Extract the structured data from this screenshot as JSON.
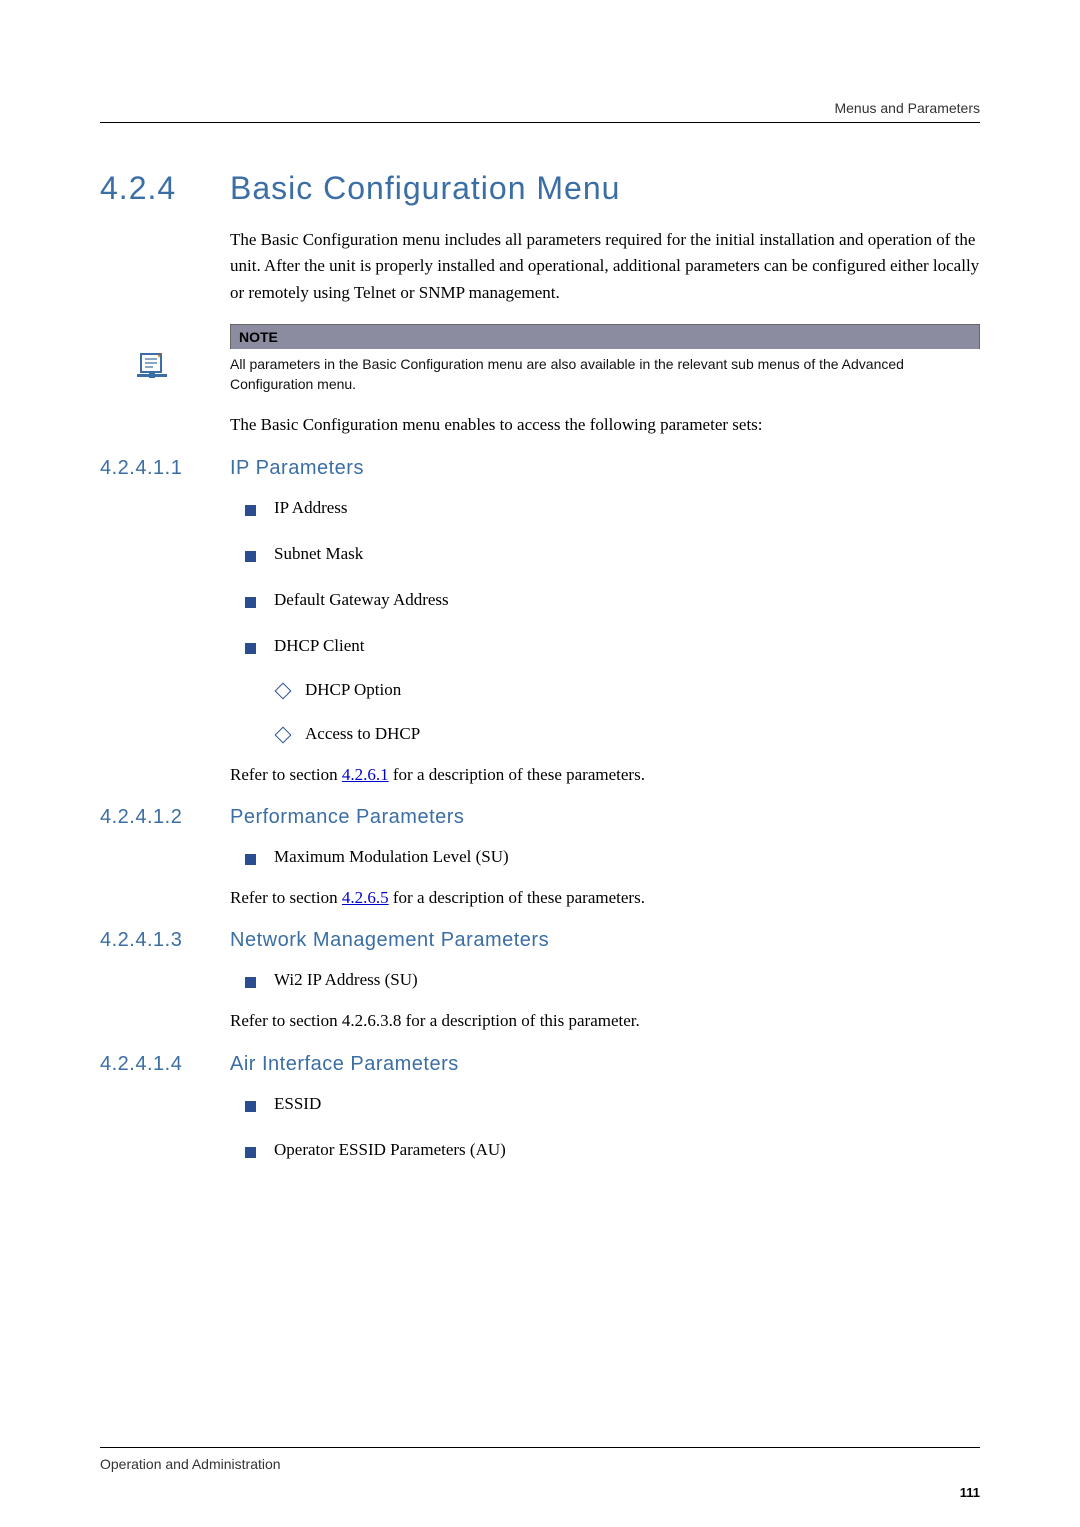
{
  "header": {
    "right": "Menus and Parameters"
  },
  "section": {
    "number": "4.2.4",
    "title": "Basic Configuration Menu",
    "intro": "The Basic Configuration menu includes all parameters required for the initial installation and operation of the unit. After the unit is properly installed and operational, additional parameters can be configured either locally or remotely using Telnet or SNMP management."
  },
  "note": {
    "label": "NOTE",
    "text": "All parameters in the Basic Configuration menu are also available in the relevant sub menus of the Advanced Configuration menu."
  },
  "after_note": "The Basic Configuration menu enables to access the following parameter sets:",
  "sub1": {
    "num": "4.2.4.1.1",
    "title": "IP Parameters",
    "items": [
      "IP Address",
      "Subnet Mask",
      "Default Gateway Address",
      "DHCP Client"
    ],
    "subitems": [
      "DHCP Option",
      "Access to DHCP"
    ],
    "refer_pre": "Refer to section ",
    "refer_link": "4.2.6.1",
    "refer_post": " for a description of these parameters."
  },
  "sub2": {
    "num": "4.2.4.1.2",
    "title": "Performance Parameters",
    "items": [
      "Maximum Modulation Level (SU)"
    ],
    "refer_pre": "Refer to section ",
    "refer_link": "4.2.6.5",
    "refer_post": " for a description of these parameters."
  },
  "sub3": {
    "num": "4.2.4.1.3",
    "title": "Network Management Parameters",
    "items": [
      "Wi2 IP Address (SU)"
    ],
    "refer": "Refer to section 4.2.6.3.8 for a description of this parameter."
  },
  "sub4": {
    "num": "4.2.4.1.4",
    "title": "Air Interface Parameters",
    "items": [
      "ESSID",
      "Operator ESSID Parameters (AU)"
    ]
  },
  "footer": {
    "left": "Operation and Administration",
    "page": "111"
  }
}
